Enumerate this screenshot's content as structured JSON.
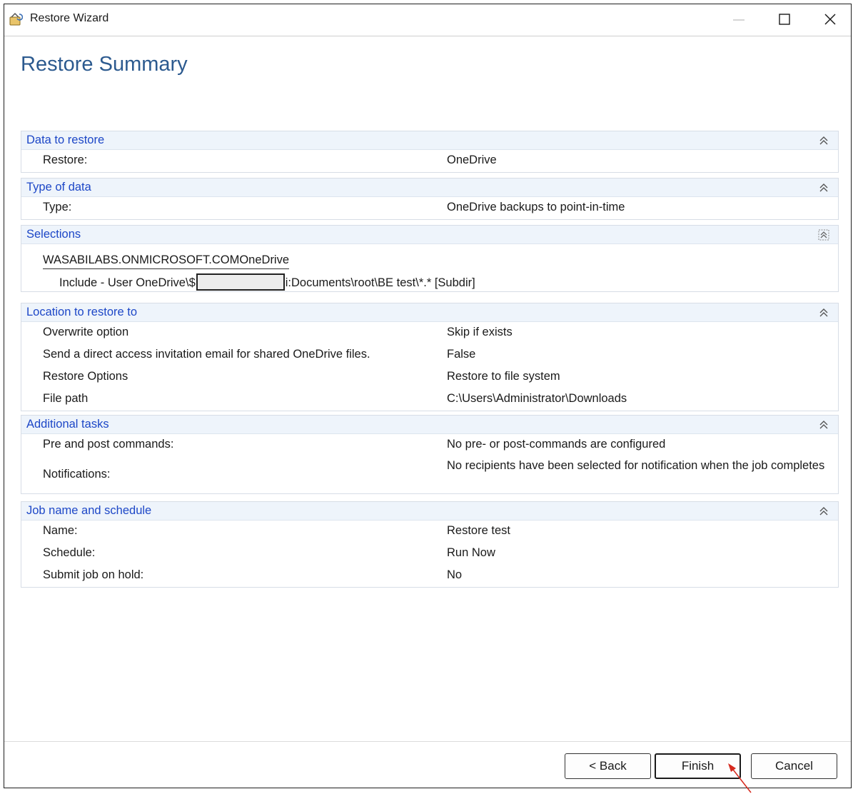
{
  "window": {
    "title": "Restore Wizard"
  },
  "page": {
    "title": "Restore Summary"
  },
  "sections": {
    "data_to_restore": {
      "title": "Data to restore",
      "rows": [
        {
          "label": "Restore:",
          "value": "OneDrive"
        }
      ]
    },
    "type_of_data": {
      "title": "Type of data",
      "rows": [
        {
          "label": "Type:",
          "value": "OneDrive backups to point-in-time"
        }
      ]
    },
    "selections": {
      "title": "Selections",
      "source": "WASABILABS.ONMICROSOFT.COMOneDrive",
      "include_prefix": "Include - User OneDrive\\$",
      "include_suffix": "i:Documents\\root\\BE test\\*.* [Subdir]"
    },
    "location": {
      "title": "Location to restore to",
      "rows": [
        {
          "label": "Overwrite option",
          "value": "Skip if exists"
        },
        {
          "label": "Send a direct access invitation email for shared OneDrive files.",
          "value": "False"
        },
        {
          "label": "Restore Options",
          "value": "Restore to file system"
        },
        {
          "label": "File path",
          "value": "C:\\Users\\Administrator\\Downloads"
        }
      ]
    },
    "additional_tasks": {
      "title": "Additional tasks",
      "rows": [
        {
          "label": "Pre and post commands:",
          "value": "No pre- or post-commands are configured"
        },
        {
          "label": "Notifications:",
          "value": "No recipients have been selected for notification when the job completes"
        }
      ]
    },
    "job": {
      "title": "Job name and schedule",
      "rows": [
        {
          "label": "Name:",
          "value": "Restore test"
        },
        {
          "label": "Schedule:",
          "value": "Run Now"
        },
        {
          "label": "Submit job on hold:",
          "value": "No"
        }
      ]
    }
  },
  "buttons": {
    "back": "< Back",
    "finish": "Finish",
    "cancel": "Cancel"
  },
  "colors": {
    "section_title": "#1d47c7",
    "page_title": "#2c5a8f",
    "section_header_bg": "#eef4fb",
    "arrow": "#d62a1e"
  }
}
